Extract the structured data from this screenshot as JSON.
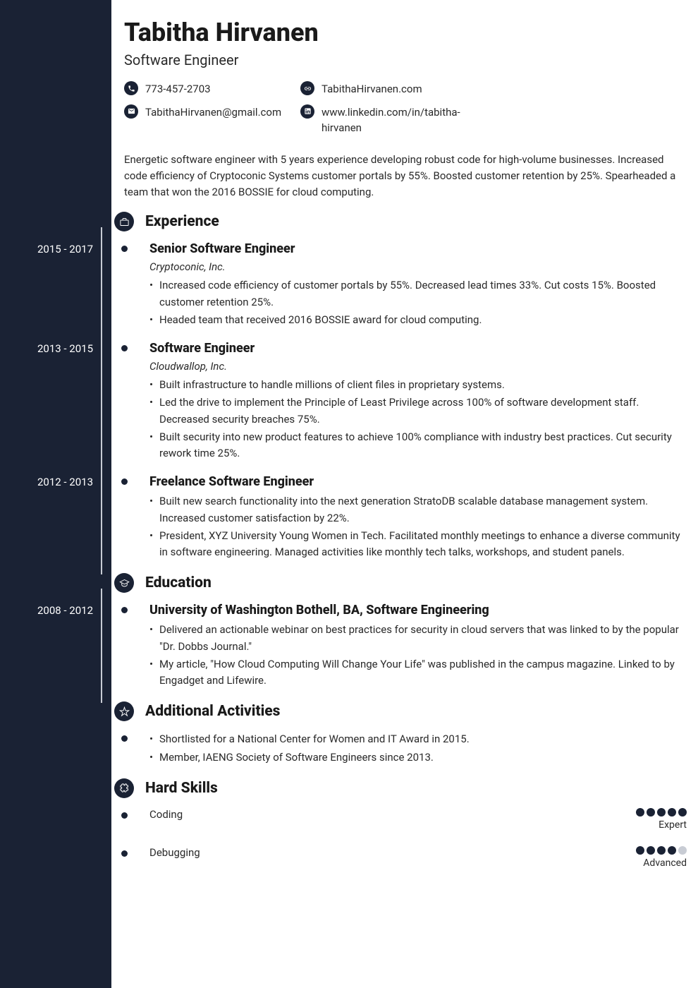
{
  "name": "Tabitha Hirvanen",
  "title": "Software Engineer",
  "contacts": {
    "phone": "773-457-2703",
    "email": "TabithaHirvanen@gmail.com",
    "website": "TabithaHirvanen.com",
    "linkedin": "www.linkedin.com/in/tabitha-hirvanen"
  },
  "summary": "Energetic software engineer with 5 years experience developing robust code for high-volume businesses. Increased code efficiency of Cryptoconic Systems customer portals by 55%. Boosted customer retention by 25%. Spearheaded a team that won the 2016 BOSSIE for cloud computing.",
  "sections": {
    "experience": "Experience",
    "education": "Education",
    "activities": "Additional Activities",
    "skills": "Hard Skills"
  },
  "experience": [
    {
      "dates": "2015 - 2017",
      "role": "Senior Software Engineer",
      "company": "Cryptoconic, Inc.",
      "bullets": [
        "Increased code efficiency of customer portals by 55%. Decreased lead times 33%. Cut costs 15%. Boosted customer retention 25%.",
        "Headed team that received 2016 BOSSIE award for cloud computing."
      ]
    },
    {
      "dates": "2013 - 2015",
      "role": "Software Engineer",
      "company": "Cloudwallop, Inc.",
      "bullets": [
        "Built infrastructure to handle millions of client files in proprietary systems.",
        "Led the drive to implement the Principle of Least Privilege across 100% of software development staff. Decreased security breaches 75%.",
        "Built security into new product features to achieve 100% compliance with industry best practices. Cut security rework time 25%."
      ]
    },
    {
      "dates": "2012 - 2013",
      "role": "Freelance Software Engineer",
      "company": "",
      "bullets": [
        "Built new search functionality into the next generation StratoDB scalable database management system. Increased customer satisfaction by 22%.",
        "President, XYZ University Young Women in Tech. Facilitated monthly meetings to enhance a diverse community in software engineering. Managed activities like monthly tech talks, workshops, and student panels."
      ]
    }
  ],
  "education": [
    {
      "dates": "2008 - 2012",
      "school": "University of Washington Bothell, BA, Software Engineering",
      "bullets": [
        "Delivered an actionable webinar on best practices for security in cloud servers that was linked to by the popular \"Dr. Dobbs Journal.\"",
        "My article, \"How Cloud Computing Will Change Your Life\" was published in the campus magazine. Linked to by Engadget and Lifewire."
      ]
    }
  ],
  "activities": [
    "Shortlisted for a National Center for Women and IT Award in 2015.",
    "Member, IAENG Society of Software Engineers since 2013."
  ],
  "skills": [
    {
      "name": "Coding",
      "level": "Expert",
      "rating": 5
    },
    {
      "name": "Debugging",
      "level": "Advanced",
      "rating": 4
    }
  ]
}
